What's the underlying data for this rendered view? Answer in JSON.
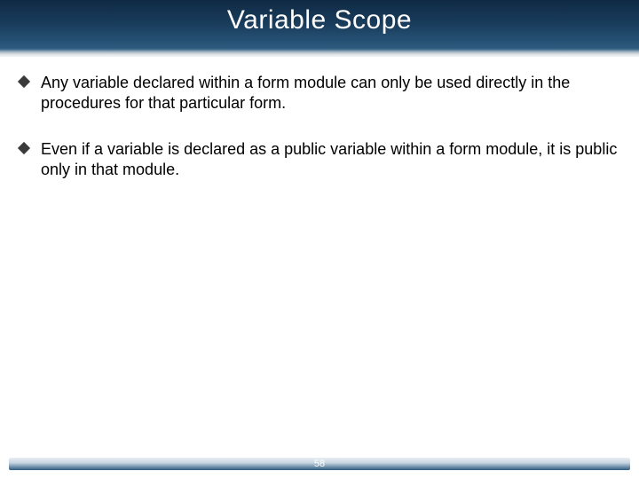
{
  "slide": {
    "title": "Variable Scope",
    "bullets": [
      "Any variable declared within a form module can only be used directly in the procedures for that particular form.",
      "Even if a variable is declared as a public variable within a form module, it is public only in that module."
    ],
    "page_number": "58"
  }
}
